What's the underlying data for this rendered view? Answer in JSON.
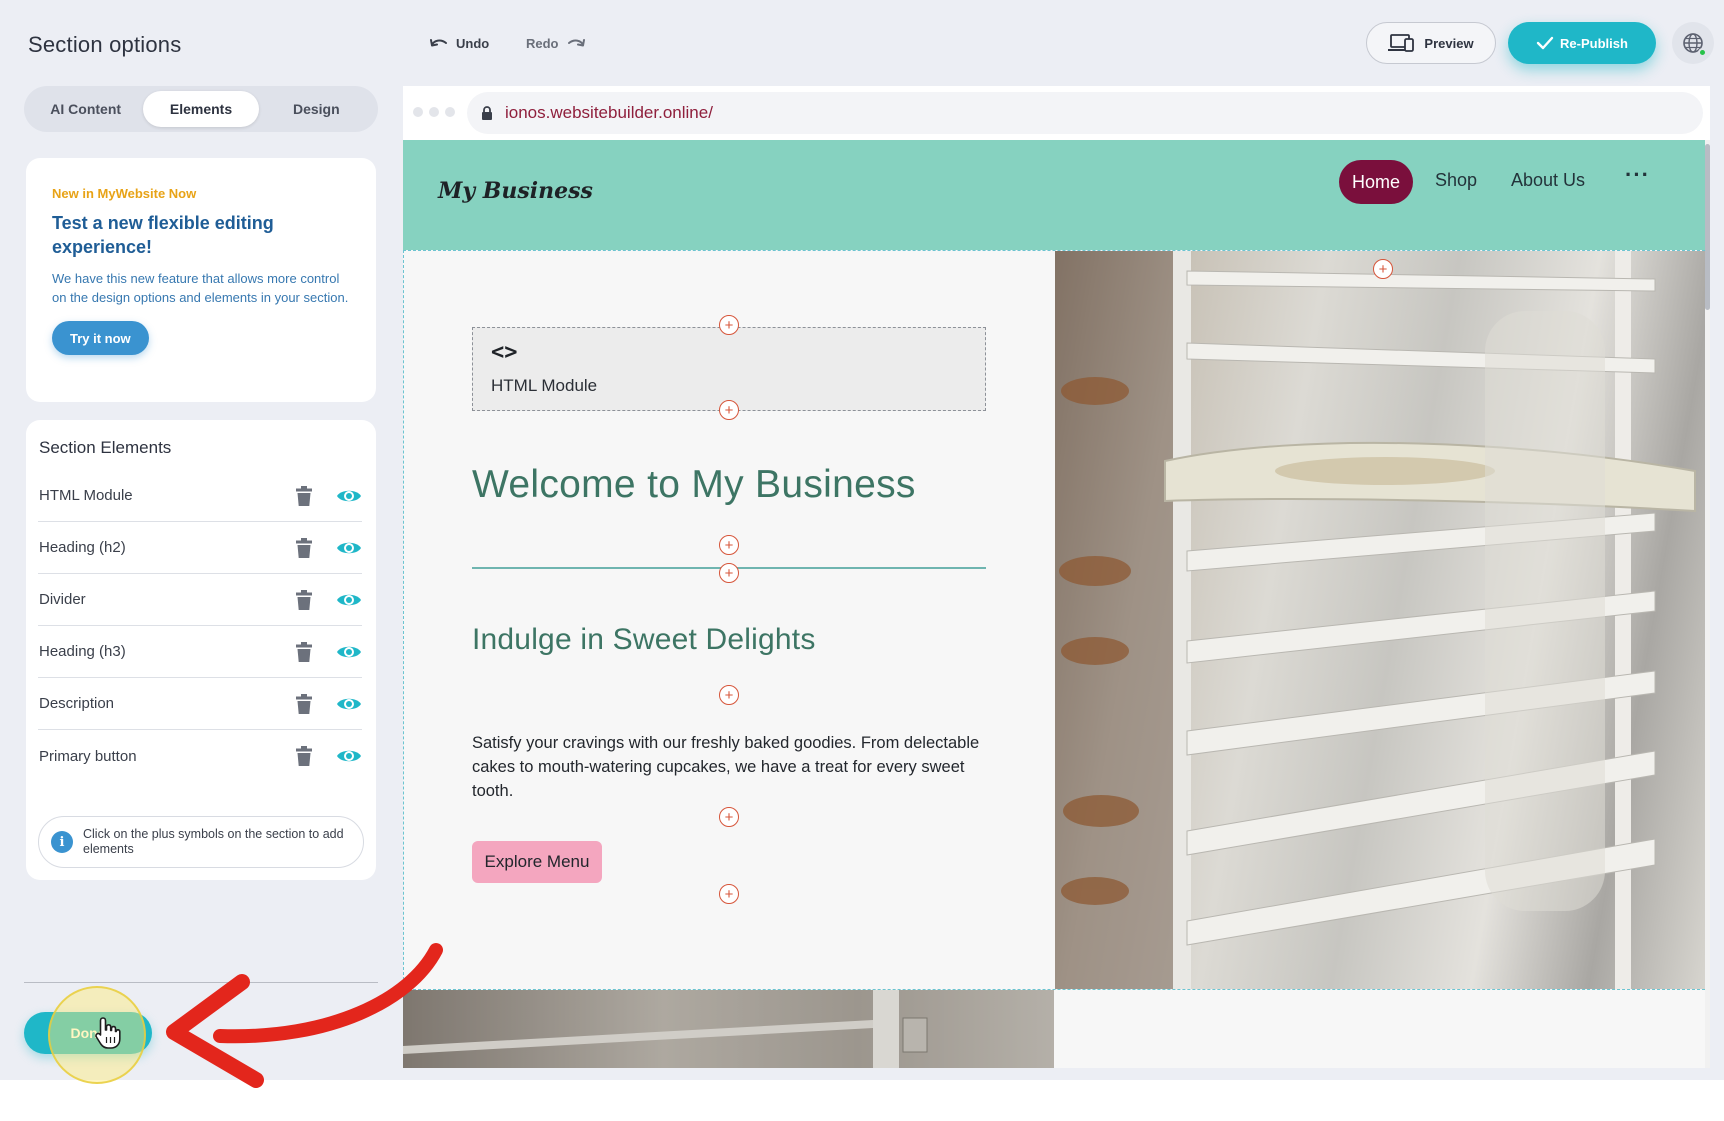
{
  "panel": {
    "title": "Section options",
    "tabs": [
      {
        "label": "AI Content",
        "active": false
      },
      {
        "label": "Elements",
        "active": true
      },
      {
        "label": "Design",
        "active": false
      }
    ],
    "promo": {
      "eyebrow": "New in MyWebsite Now",
      "title": "Test a new flexible editing experience!",
      "body": "We have this new feature that allows more control on the design options and elements in your section.",
      "button": "Try it now"
    },
    "elements": {
      "title": "Section Elements",
      "items": [
        {
          "label": "HTML Module",
          "visible": true
        },
        {
          "label": "Heading (h2)",
          "visible": true
        },
        {
          "label": "Divider",
          "visible": true
        },
        {
          "label": "Heading (h3)",
          "visible": true
        },
        {
          "label": "Description",
          "visible": true
        },
        {
          "label": "Primary button",
          "visible": true
        }
      ],
      "hint": "Click on the plus symbols on the section to add elements",
      "hint_icon": "info-icon"
    },
    "done_button": "Done"
  },
  "toolbar": {
    "undo": "Undo",
    "redo": "Redo",
    "preview": "Preview",
    "publish": "Re-Publish",
    "language_icon": "globe-icon"
  },
  "browser": {
    "url": "ionos.websitebuilder.online/"
  },
  "site": {
    "logo": "My Business",
    "nav": [
      "Home",
      "Shop",
      "About Us",
      "···"
    ],
    "active_nav": "Home",
    "html_module": {
      "glyph": "<>",
      "label": "HTML Module"
    },
    "heading_h2": "Welcome to My Business",
    "heading_h3": "Indulge in Sweet Delights",
    "description": "Satisfy your cravings with our freshly baked goodies. From delectable cakes to mouth-watering cupcakes, we have a treat for every sweet tooth.",
    "cta": "Explore Menu"
  },
  "colors": {
    "accent": "#1fb7c8",
    "nav_bg": "#86d2c0",
    "home_active": "#7a0f3c",
    "heading": "#3d7564",
    "cta_bg": "#f4a6bf",
    "plus": "#d6553a",
    "url_text": "#8f1f3c",
    "promo_eyebrow": "#e8a317",
    "promo_title": "#1f5d96"
  }
}
